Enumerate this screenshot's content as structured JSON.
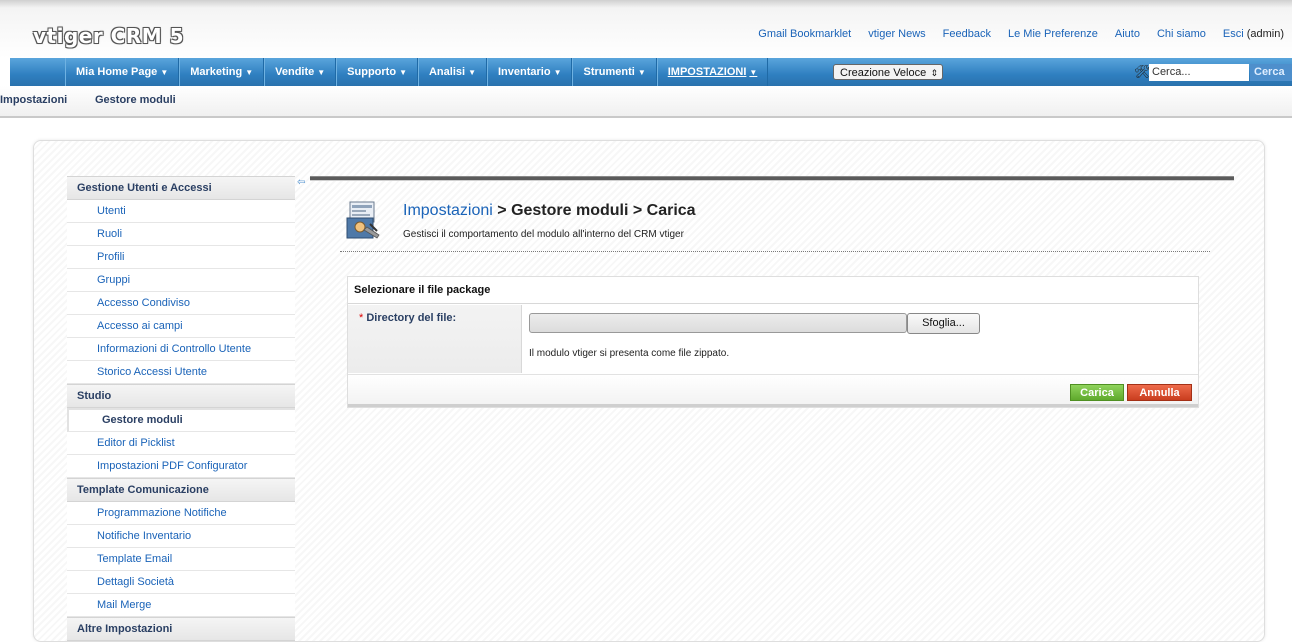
{
  "header": {
    "logo": "vtiger CRM 5",
    "links": [
      "Gmail Bookmarklet",
      "vtiger News",
      "Feedback",
      "Le Mie Preferenze",
      "Aiuto",
      "Chi siamo"
    ],
    "logout_label": "Esci",
    "user": "(admin)"
  },
  "nav": {
    "items": [
      "Mia Home Page",
      "Marketing",
      "Vendite",
      "Supporto",
      "Analisi",
      "Inventario",
      "Strumenti",
      "IMPOSTAZIONI"
    ],
    "quick_create": "Creazione Veloce",
    "search_placeholder": "Cerca...",
    "search_button": "Cerca"
  },
  "breadcrumb": [
    "Impostazioni",
    "Gestore moduli"
  ],
  "sidebar": {
    "sections": [
      {
        "title": "Gestione Utenti e Accessi",
        "items": [
          "Utenti",
          "Ruoli",
          "Profili",
          "Gruppi",
          "Accesso Condiviso",
          "Accesso ai campi",
          "Informazioni di Controllo Utente",
          "Storico Accessi Utente"
        ]
      },
      {
        "title": "Studio",
        "items": [
          "Gestore moduli",
          "Editor di Picklist",
          "Impostazioni PDF Configurator"
        ]
      },
      {
        "title": "Template Comunicazione",
        "items": [
          "Programmazione Notifiche",
          "Notifiche Inventario",
          "Template Email",
          "Dettagli Società",
          "Mail Merge"
        ]
      },
      {
        "title": "Altre Impostazioni",
        "items": []
      }
    ],
    "active_item": "Gestore moduli"
  },
  "page": {
    "title_link": "Impostazioni",
    "title_rest": " > Gestore moduli > Carica",
    "subtitle": "Gestisci il comportamento del modulo all'interno del CRM vtiger"
  },
  "form": {
    "heading": "Selezionare il file package",
    "required_mark": "*",
    "label": "Directory del file:",
    "browse_button": "Sfoglia...",
    "hint": "Il modulo vtiger si presenta come file zippato.",
    "submit": "Carica",
    "cancel": "Annulla"
  }
}
